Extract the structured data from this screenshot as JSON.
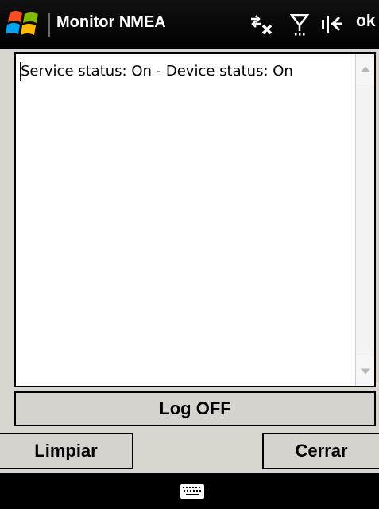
{
  "window": {
    "title": "Monitor NMEA",
    "ok_label": "ok"
  },
  "status_icons": [
    "connectivity-off-icon",
    "signal-icon",
    "volume-icon"
  ],
  "log": {
    "text": "Service status: On - Device status: On"
  },
  "buttons": {
    "log_toggle": "Log OFF",
    "clear": "Limpiar",
    "close": "Cerrar"
  },
  "bottom_bar": {
    "input_icon": "keyboard-icon"
  },
  "colors": {
    "titlebar": "#000000",
    "form_background": "#d9d6d0",
    "button_face": "#d6d3ce",
    "log_background": "#ffffff"
  }
}
